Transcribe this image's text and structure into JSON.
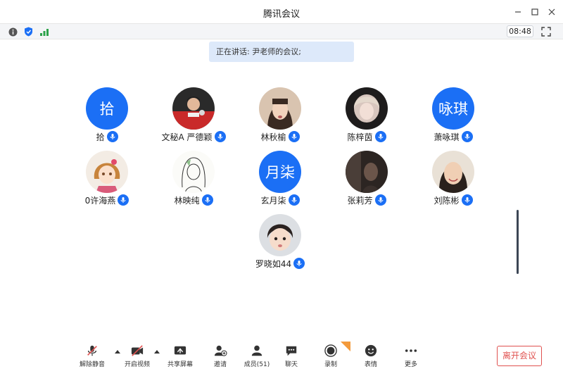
{
  "app": {
    "title": "腾讯会议"
  },
  "status": {
    "time": "08:48"
  },
  "speaking": {
    "text": "正在讲话: 尹老师的会议;"
  },
  "participants": [
    {
      "name": "拾",
      "avatar_text": "拾"
    },
    {
      "name": "文秘A 严德颖",
      "avatar_text": ""
    },
    {
      "name": "林秋榆",
      "avatar_text": ""
    },
    {
      "name": "陈梓茵",
      "avatar_text": ""
    },
    {
      "name": "萧咏琪",
      "avatar_text": "咏琪"
    },
    {
      "name": "0许海燕",
      "avatar_text": ""
    },
    {
      "name": "林映纯",
      "avatar_text": ""
    },
    {
      "name": "玄月柒",
      "avatar_text": "月柒"
    },
    {
      "name": "张莉芳",
      "avatar_text": ""
    },
    {
      "name": "刘陈彬",
      "avatar_text": ""
    },
    {
      "name": "罗晓如44",
      "avatar_text": ""
    }
  ],
  "toolbar": {
    "unmute": "解除静音",
    "start_video": "开启视频",
    "share_screen": "共享屏幕",
    "invite": "邀请",
    "members": "成员(51)",
    "chat": "聊天",
    "record": "录制",
    "reactions": "表情",
    "more": "更多",
    "leave": "离开会议"
  },
  "colors": {
    "accent": "#1b6ff5",
    "leave": "#e0514f",
    "banner": "#dde9fa"
  }
}
